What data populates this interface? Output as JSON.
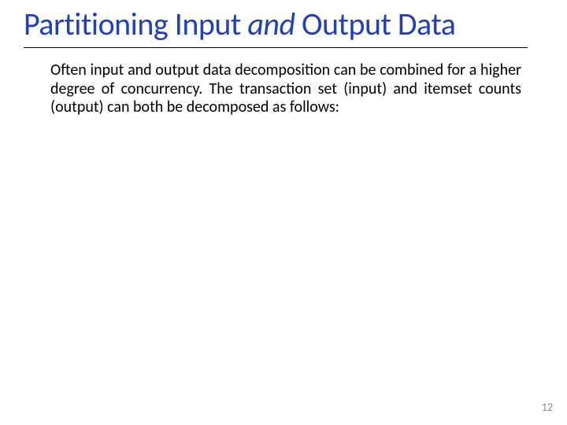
{
  "title": {
    "prefix": "Partitioning Input ",
    "italic": "and",
    "suffix": " Output Data"
  },
  "body": {
    "text": "Often input and output data decomposition can be combined for a higher degree of concurrency. The transaction set (input) and itemset counts (output) can both be decomposed as follows:"
  },
  "pageNumber": "12"
}
